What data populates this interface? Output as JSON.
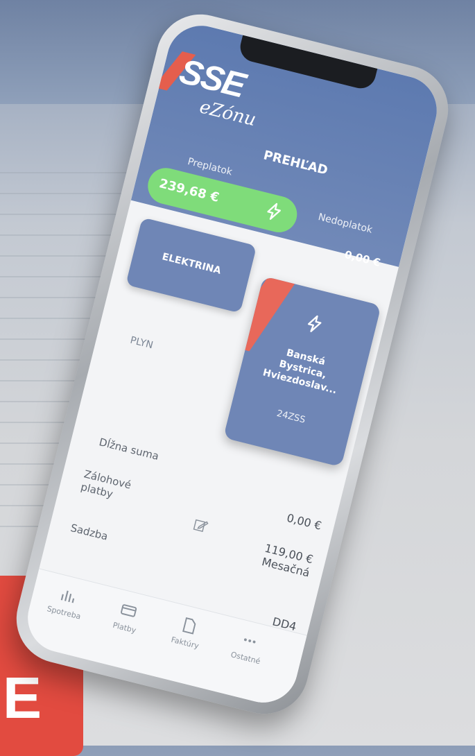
{
  "app": {
    "logo_text": "SSE",
    "logo_sub": "eZónu",
    "page_title": "PREHĽAD"
  },
  "summary": {
    "preplatok_label": "Preplatok",
    "preplatok_value": "239,68 €",
    "nedoplatok_label": "Nedoplatok",
    "nedoplatok_value": "0,00 €"
  },
  "tabs": {
    "electricity": "ELEKTRINA",
    "gas": "PLYN"
  },
  "place_card": {
    "address": "Banská\nBystrica,\nHviezdoslav...",
    "code": "24ZSS"
  },
  "details": {
    "due_label": "Dĺžna suma",
    "due_value": "0,00 €",
    "advance_label": "Zálohové\nplatby",
    "advance_value": "119,00 €",
    "advance_period": "Mesačná",
    "rate_label": "Sadzba",
    "rate_value": "DD4"
  },
  "bottom_nav": [
    "Spotreba",
    "Platby",
    "Faktúry",
    "Ostatné"
  ],
  "brand_tile_letter": "E",
  "colors": {
    "header": "#5d7ab0",
    "card": "#6f86b6",
    "accent_green": "#7fdc7a",
    "accent_red": "#e55e4d"
  },
  "icons": [
    "lightning-icon",
    "edit-icon",
    "consumption-icon",
    "payments-icon",
    "invoices-icon",
    "more-icon"
  ]
}
